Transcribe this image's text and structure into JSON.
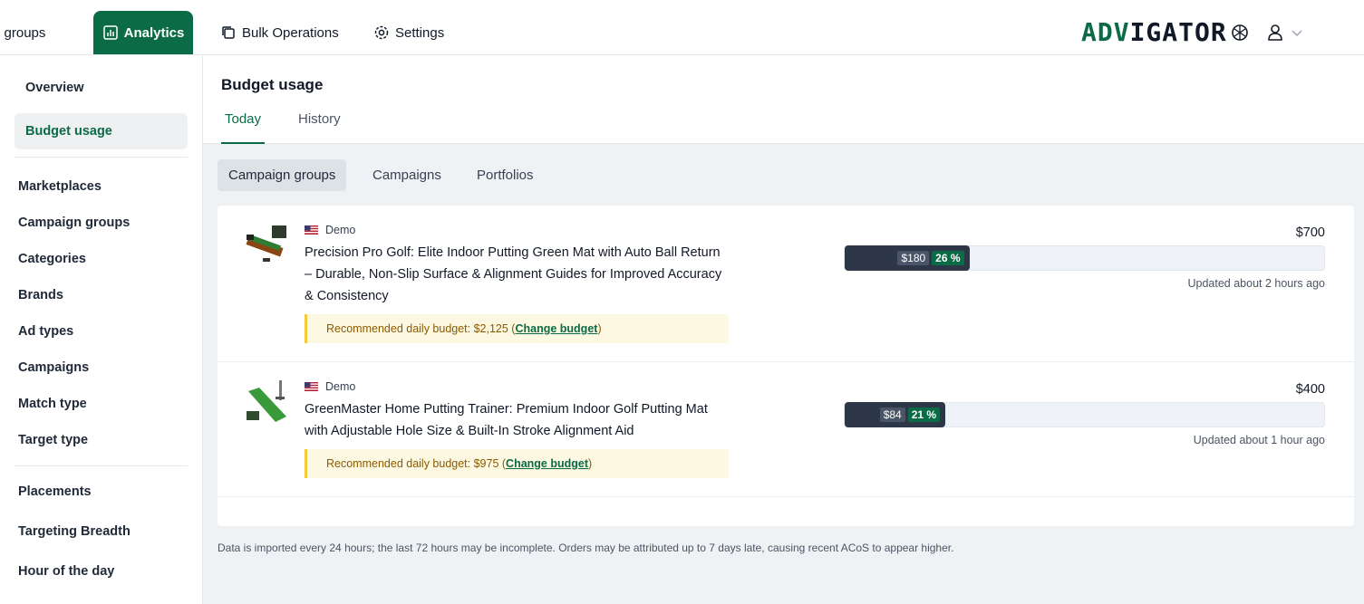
{
  "nav": {
    "campaign_groups": "aign groups",
    "analytics": "Analytics",
    "bulk_operations": "Bulk Operations",
    "settings": "Settings"
  },
  "logo": {
    "part1": "ADV",
    "part2": "IGATOR"
  },
  "sidebar": {
    "overview": "Overview",
    "budget_usage": "Budget usage",
    "items": [
      "Marketplaces",
      "Campaign groups",
      "Categories",
      "Brands",
      "Ad types",
      "Campaigns",
      "Match type",
      "Target type"
    ],
    "items2": [
      "Placements",
      "Targeting Breadth",
      "Hour of the day"
    ]
  },
  "page": {
    "title": "Budget usage",
    "tabs": [
      "Today",
      "History"
    ],
    "subtabs": [
      "Campaign groups",
      "Campaigns",
      "Portfolios"
    ]
  },
  "rows": [
    {
      "marketplace": "Demo",
      "title": "Precision Pro Golf: Elite Indoor Putting Green Mat with Auto Ball Return – Durable, Non-Slip Surface & Alignment Guides for Improved Accuracy & Consistency",
      "reco_text": "Recommended daily budget: $2,125 (",
      "reco_link": "Change budget",
      "reco_close": ")",
      "budget": "$700",
      "spent": "$180",
      "percent": "26 %",
      "percent_value": 26,
      "updated": "Updated about 2 hours ago"
    },
    {
      "marketplace": "Demo",
      "title": "GreenMaster Home Putting Trainer: Premium Indoor Golf Putting Mat with Adjustable Hole Size & Built-In Stroke Alignment Aid",
      "reco_text": "Recommended daily budget: $975 (",
      "reco_link": "Change budget",
      "reco_close": ")",
      "budget": "$400",
      "spent": "$84",
      "percent": "21 %",
      "percent_value": 21,
      "updated": "Updated about 1 hour ago"
    }
  ],
  "footnote": "Data is imported every 24 hours; the last 72 hours may be incomplete. Orders may be attributed up to 7 days late, causing recent ACoS to appear higher.",
  "colors": {
    "brand": "#0b6b46",
    "bar": "#2d3748",
    "reco_bg": "#fdf8e1",
    "reco_border": "#f2cc3a"
  }
}
